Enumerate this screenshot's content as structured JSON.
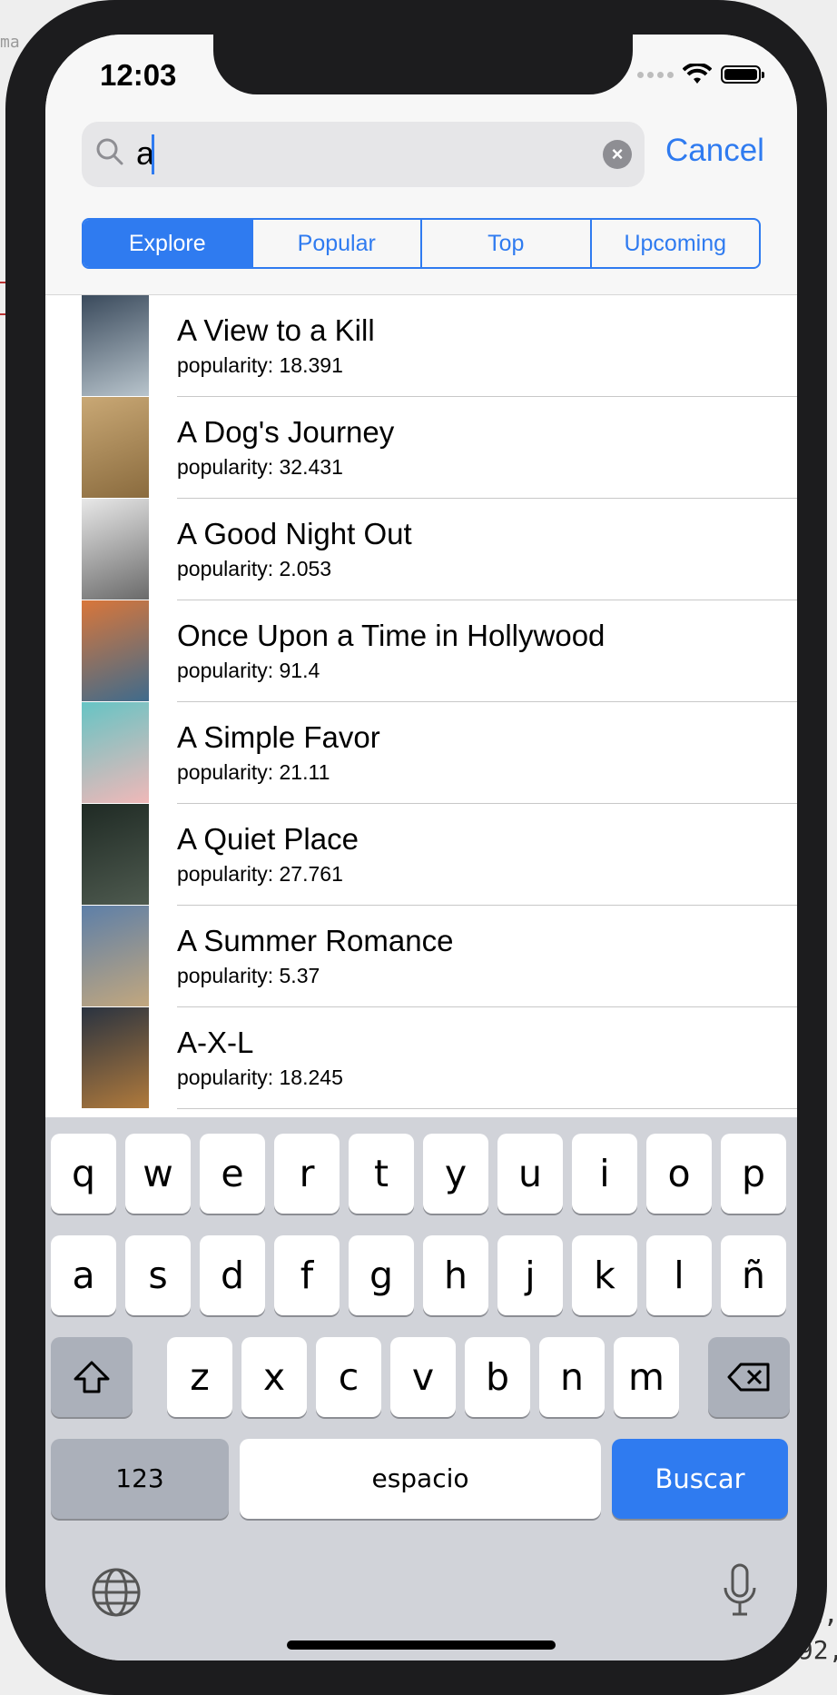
{
  "status_bar": {
    "time": "12:03"
  },
  "search": {
    "query": "a",
    "cancel_label": "Cancel"
  },
  "segments": [
    {
      "label": "Explore",
      "active": true
    },
    {
      "label": "Popular",
      "active": false
    },
    {
      "label": "Top",
      "active": false
    },
    {
      "label": "Upcoming",
      "active": false
    }
  ],
  "movies": [
    {
      "title": "A View to a Kill",
      "popularity": "popularity: 18.391",
      "poster_colors": [
        "#3a4a5c",
        "#b8c4cc"
      ]
    },
    {
      "title": "A Dog's Journey",
      "popularity": "popularity: 32.431",
      "poster_colors": [
        "#c9a875",
        "#8a6b3e"
      ]
    },
    {
      "title": "A Good Night Out",
      "popularity": "popularity: 2.053",
      "poster_colors": [
        "#e8e8e8",
        "#6a6a6a"
      ]
    },
    {
      "title": "Once Upon a Time in Hollywood",
      "popularity": "popularity: 91.4",
      "poster_colors": [
        "#d9763a",
        "#3f6b8c"
      ]
    },
    {
      "title": "A Simple Favor",
      "popularity": "popularity: 21.11",
      "poster_colors": [
        "#66c4c4",
        "#f0b8b8"
      ]
    },
    {
      "title": "A Quiet Place",
      "popularity": "popularity: 27.761",
      "poster_colors": [
        "#1f2a24",
        "#4e5a4f"
      ]
    },
    {
      "title": "A Summer Romance",
      "popularity": "popularity: 5.37",
      "poster_colors": [
        "#5d7fa8",
        "#c2a77e"
      ]
    },
    {
      "title": "A-X-L",
      "popularity": "popularity: 18.245",
      "poster_colors": [
        "#2a3340",
        "#b07a3c"
      ]
    }
  ],
  "keyboard": {
    "row1": [
      "q",
      "w",
      "e",
      "r",
      "t",
      "y",
      "u",
      "i",
      "o",
      "p"
    ],
    "row2": [
      "a",
      "s",
      "d",
      "f",
      "g",
      "h",
      "j",
      "k",
      "l",
      "ñ"
    ],
    "row3": [
      "z",
      "x",
      "c",
      "v",
      "b",
      "n",
      "m"
    ],
    "numbers_label": "123",
    "space_label": "espacio",
    "return_label": "Buscar"
  },
  "colors": {
    "accent": "#2f7bf0",
    "keyboard_bg": "#d1d3d9",
    "device": "#1c1c1e"
  }
}
